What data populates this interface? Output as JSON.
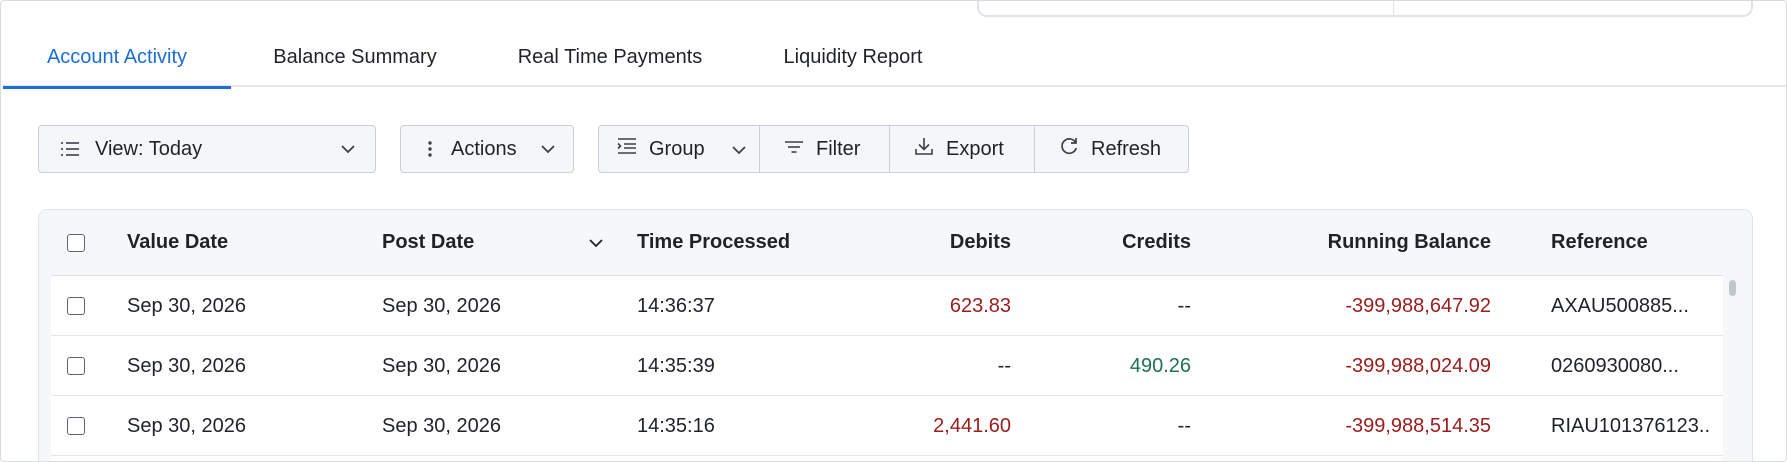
{
  "tabs": [
    {
      "label": "Account Activity",
      "active": true
    },
    {
      "label": "Balance Summary",
      "active": false
    },
    {
      "label": "Real Time Payments",
      "active": false
    },
    {
      "label": "Liquidity Report",
      "active": false
    }
  ],
  "toolbar": {
    "view_label": "View: Today",
    "actions_label": "Actions",
    "group_label": "Group",
    "filter_label": "Filter",
    "export_label": "Export",
    "refresh_label": "Refresh"
  },
  "table": {
    "columns": {
      "value_date": "Value Date",
      "post_date": "Post Date",
      "time_processed": "Time Processed",
      "debits": "Debits",
      "credits": "Credits",
      "running_balance": "Running Balance",
      "reference": "Reference"
    },
    "rows": [
      {
        "value_date": "Sep 30, 2026",
        "post_date": "Sep 30, 2026",
        "time_processed": "14:36:37",
        "debits": "623.83",
        "credits": "--",
        "running_balance": "-399,988,647.92",
        "reference": "AXAU500885..."
      },
      {
        "value_date": "Sep 30, 2026",
        "post_date": "Sep 30, 2026",
        "time_processed": "14:35:39",
        "debits": "--",
        "credits": "490.26",
        "running_balance": "-399,988,024.09",
        "reference": "0260930080..."
      },
      {
        "value_date": "Sep 30, 2026",
        "post_date": "Sep 30, 2026",
        "time_processed": "14:35:16",
        "debits": "2,441.60",
        "credits": "--",
        "running_balance": "-399,988,514.35",
        "reference": "RIAU101376123..."
      }
    ]
  },
  "colors": {
    "accent": "#1b6fd6",
    "debit": "#9b1c1c",
    "credit": "#1f6f55"
  },
  "icons": {
    "view": "list-icon",
    "actions": "more-vertical-icon",
    "group": "indent-list-icon",
    "filter": "filter-icon",
    "export": "download-icon",
    "refresh": "refresh-icon",
    "sort": "chevron-down-icon"
  }
}
